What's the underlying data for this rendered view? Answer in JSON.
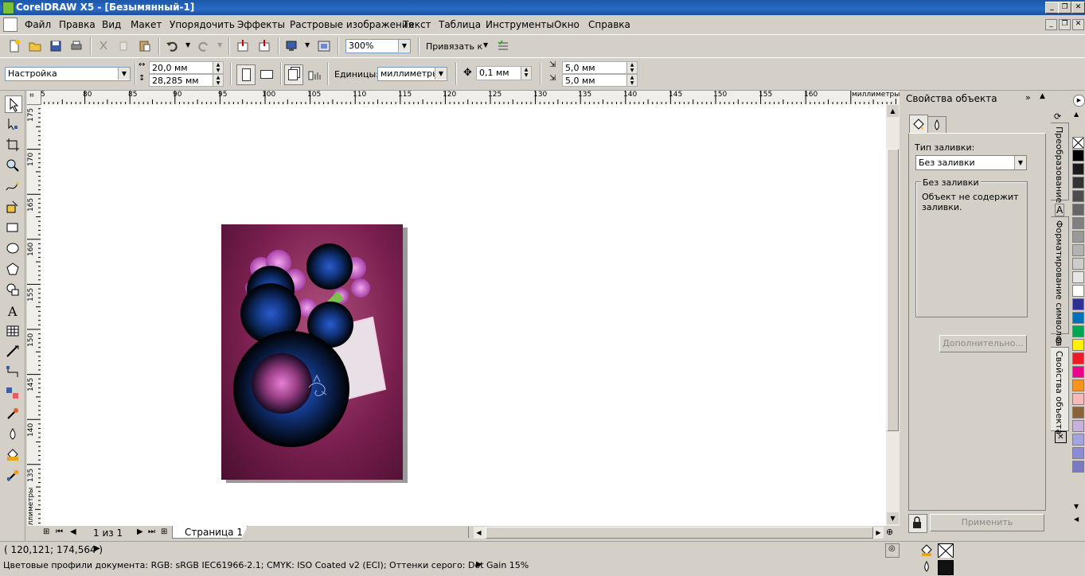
{
  "window": {
    "title": "CorelDRAW X5 - [Безымянный-1]"
  },
  "menu": [
    "Файл",
    "Правка",
    "Вид",
    "Макет",
    "Упорядочить",
    "Эффекты",
    "Растровые изображения",
    "Текст",
    "Таблица",
    "Инструменты",
    "Окно",
    "Справка"
  ],
  "standard_toolbar": {
    "zoom": "300%",
    "snap_label": "Привязать к"
  },
  "property_bar": {
    "preset": "Настройка",
    "width": "20,0 мм",
    "height": "28,285 мм",
    "units_label": "Единицы:",
    "units_value": "миллиметры",
    "nudge": "0,1 мм",
    "dup_x": "5,0 мм",
    "dup_y": "5,0 мм"
  },
  "rulers": {
    "unit": "миллиметры",
    "h_ticks": [
      "5",
      "80",
      "85",
      "90",
      "95",
      "100",
      "105",
      "110",
      "115",
      "120",
      "125",
      "130",
      "135",
      "140",
      "145",
      "150",
      "155",
      "160"
    ],
    "v_ticks": [
      "175",
      "170",
      "165",
      "160",
      "155",
      "150",
      "145",
      "140",
      "135"
    ],
    "v_unit": "миллиметры"
  },
  "page_nav": {
    "counter": "1 из 1",
    "tab": "Страница 1"
  },
  "docker": {
    "title": "Свойства объекта",
    "fill_type_label": "Тип заливки:",
    "fill_type_value": "Без заливки",
    "group_title": "Без заливки",
    "group_text": "Объект не содержит заливки.",
    "more_button": "Дополнительно...",
    "apply_button": "Применить"
  },
  "docker_tabs": [
    "Преобразование",
    "Форматирование символов",
    "Свойства объекта"
  ],
  "palette_colors": [
    "#000000",
    "#1a1a1a",
    "#333333",
    "#4d4d4d",
    "#666666",
    "#808080",
    "#999999",
    "#b3b3b3",
    "#cccccc",
    "#e6e6e6",
    "#ffffff",
    "#2e3192",
    "#0072bc",
    "#00a651",
    "#fff200",
    "#ed1c24",
    "#ec008c",
    "#f7941d",
    "#f9b8b8",
    "#8c6239",
    "#c7b2de",
    "#a3a3e0",
    "#8c8cd6",
    "#7a7ac4"
  ],
  "status": {
    "coords": "( 120,121; 174,564 )",
    "color_profiles": "Цветовые профили документа: RGB: sRGB IEC61966-2.1; CMYK: ISO Coated v2 (ECI); Оттенки серого: Dot Gain 15%"
  }
}
